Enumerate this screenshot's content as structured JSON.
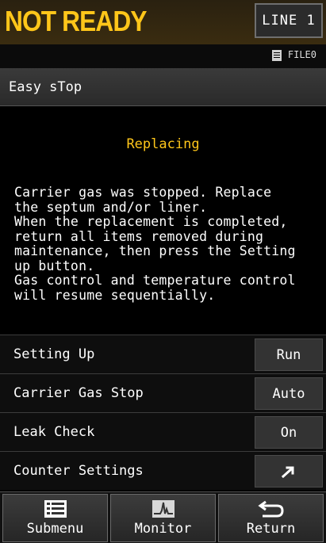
{
  "status": {
    "text": "NOT READY",
    "color": "#ffc61a"
  },
  "line_button": {
    "label": "LINE 1"
  },
  "file": {
    "icon": "file-icon",
    "label": "FILE0"
  },
  "section": {
    "title": "Easy sTop"
  },
  "content": {
    "heading": "Replacing",
    "message": "Carrier gas was stopped. Replace\nthe septum and/or liner.\nWhen the replacement is completed,\nreturn all items removed during\nmaintenance, then press the Setting\nup button.\nGas control and temperature control\nwill resume sequentially."
  },
  "rows": [
    {
      "label": "Setting Up",
      "button": "Run"
    },
    {
      "label": "Carrier Gas Stop",
      "button": "Auto"
    },
    {
      "label": "Leak Check",
      "button": "On"
    },
    {
      "label": "Counter Settings",
      "button_icon": "arrow-icon"
    }
  ],
  "nav": [
    {
      "label": "Submenu",
      "icon": "list-icon"
    },
    {
      "label": "Monitor",
      "icon": "monitor-icon"
    },
    {
      "label": "Return",
      "icon": "return-icon"
    }
  ]
}
